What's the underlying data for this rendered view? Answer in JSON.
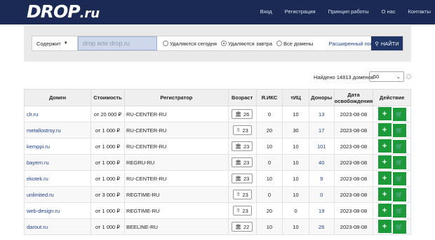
{
  "header": {
    "logo_main": "DROP",
    "logo_suffix": ".ru",
    "nav": [
      "Вход",
      "Регистрация",
      "Принцип работы",
      "О нас",
      "Контакты"
    ]
  },
  "search": {
    "mode_select": "Содержит",
    "placeholder": "drop или drop.ru",
    "radio_today": "Удаляются сегодня",
    "radio_tomorrow": "Удаляются завтра",
    "radio_all": "Все домены",
    "advanced": "Расширенный поиск",
    "find_button": "НАЙТИ"
  },
  "results": {
    "found_text": "Найдено 14813 доменов",
    "per_page": "50"
  },
  "table": {
    "headers": [
      "Домен",
      "Стоимость",
      "Регистратор",
      "Возраст",
      "Я.ИКС",
      "тИЦ",
      "Доноры",
      "Дата освобождения",
      "Действие"
    ],
    "rows": [
      {
        "domain": "clr.ru",
        "price": "от 20 000 ₽",
        "registrar": "RU-CENTER-RU",
        "age": "26",
        "age_icon": "bank-icon",
        "iks": "0",
        "tic": "10",
        "donors": "13",
        "date": "2023-08-08"
      },
      {
        "domain": "metallostroy.ru",
        "price": "от 1 000 ₽",
        "registrar": "RU-CENTER-RU",
        "age": "23",
        "age_icon": "up-icon",
        "iks": "20",
        "tic": "30",
        "donors": "17",
        "date": "2023-08-08"
      },
      {
        "domain": "kemppi.ru",
        "price": "от 1 000 ₽",
        "registrar": "RU-CENTER-RU",
        "age": "23",
        "age_icon": "bank-icon",
        "iks": "10",
        "tic": "10",
        "donors": "101",
        "date": "2023-08-08"
      },
      {
        "domain": "bayern.ru",
        "price": "от 1 000 ₽",
        "registrar": "REGRU-RU",
        "age": "23",
        "age_icon": "bank-icon",
        "iks": "0",
        "tic": "10",
        "donors": "40",
        "date": "2023-08-08"
      },
      {
        "domain": "ekotek.ru",
        "price": "от 1 000 ₽",
        "registrar": "RU-CENTER-RU",
        "age": "23",
        "age_icon": "bank-icon",
        "iks": "10",
        "tic": "10",
        "donors": "9",
        "date": "2023-08-08"
      },
      {
        "domain": "unlimited.ru",
        "price": "от 3 000 ₽",
        "registrar": "REGTIME-RU",
        "age": "23",
        "age_icon": "up-icon",
        "iks": "0",
        "tic": "10",
        "donors": "0",
        "date": "2023-08-08"
      },
      {
        "domain": "web-design.ru",
        "price": "от 1 000 ₽",
        "registrar": "REGTIME-RU",
        "age": "23",
        "age_icon": "up-icon",
        "iks": "20",
        "tic": "0",
        "donors": "19",
        "date": "2023-08-08"
      },
      {
        "domain": "darout.ru",
        "price": "от 1 000 ₽",
        "registrar": "BEELINE-RU",
        "age": "22",
        "age_icon": "bank-icon",
        "iks": "10",
        "tic": "10",
        "donors": "26",
        "date": "2023-08-08"
      }
    ]
  }
}
